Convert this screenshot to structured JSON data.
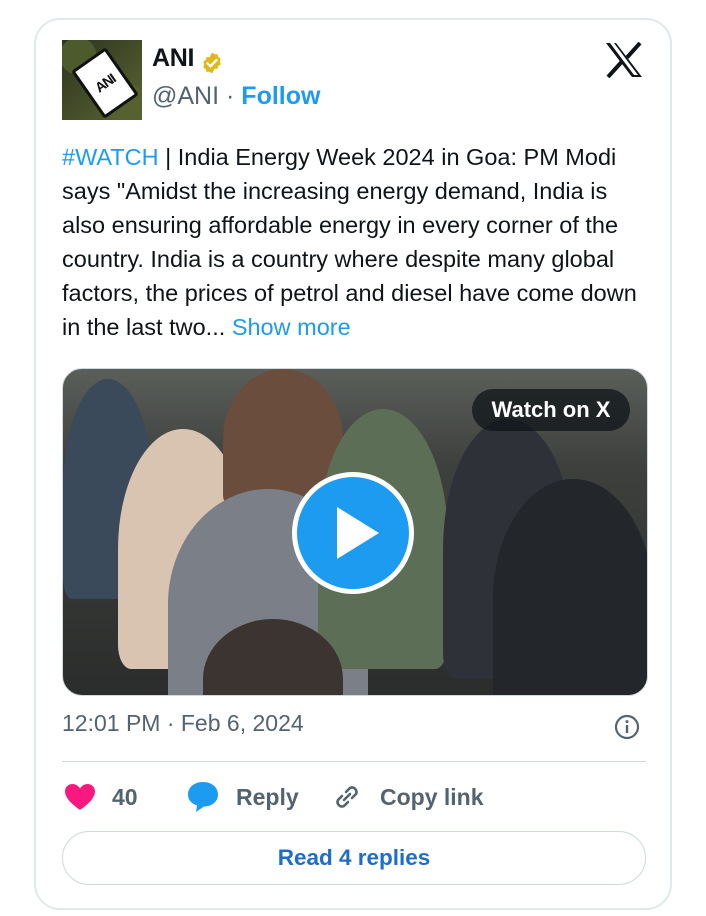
{
  "author": {
    "name": "ANI",
    "handle": "@ANI",
    "separator": "·",
    "follow_label": "Follow",
    "avatar_text": "ANI"
  },
  "icons": {
    "verified": "verified-badge-icon",
    "platform": "x-logo-icon",
    "info": "info-icon",
    "like": "heart-icon",
    "reply": "speech-bubble-icon",
    "copy_link": "link-icon",
    "play": "play-icon"
  },
  "colors": {
    "accent": "#1d9bf0",
    "like": "#f91880",
    "verified": "#e2b719"
  },
  "tweet": {
    "hashtag": "#WATCH",
    "text": " | India Energy Week 2024 in Goa: PM Modi says \"Amidst the increasing energy demand, India is also ensuring affordable energy in every corner of the country. India is a country where despite many global factors, the prices of petrol and diesel have come down in the last two... ",
    "show_more": "Show more"
  },
  "media": {
    "watch_label": "Watch on X"
  },
  "meta": {
    "timestamp": "12:01 PM · Feb 6, 2024"
  },
  "actions": {
    "like_count": "40",
    "reply_label": "Reply",
    "copy_label": "Copy link"
  },
  "footer": {
    "read_replies": "Read 4 replies"
  }
}
